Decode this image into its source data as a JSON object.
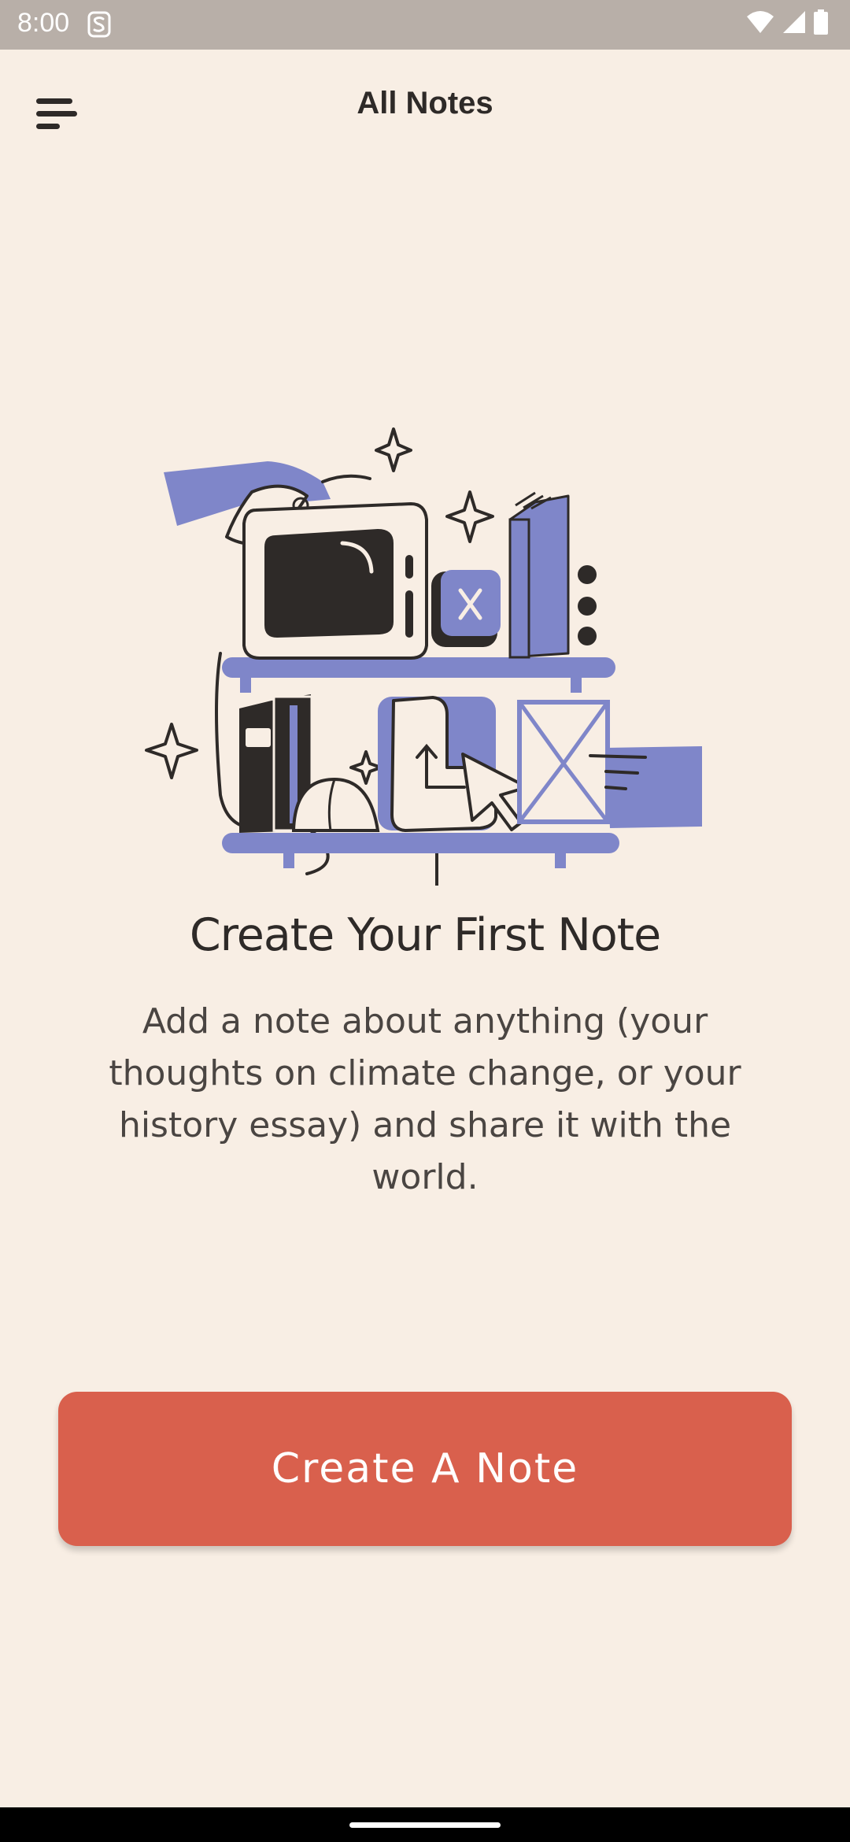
{
  "status_bar": {
    "time": "8:00",
    "icons": [
      "app-notification-icon",
      "wifi-icon",
      "cellular-signal-icon",
      "battery-icon"
    ]
  },
  "header": {
    "title": "All Notes",
    "menu_icon": "menu-icon"
  },
  "empty_state": {
    "illustration": "notes-shelf-illustration",
    "title": "Create Your First Note",
    "description": "Add a note about anything (your thoughts on climate change, or your history essay) and share it with the world."
  },
  "primary_action": {
    "label": "Create A Note"
  },
  "colors": {
    "background": "#f8eee4",
    "accent": "#d9604d",
    "illustration_purple": "#7f86c9",
    "ink": "#2e2a28"
  }
}
